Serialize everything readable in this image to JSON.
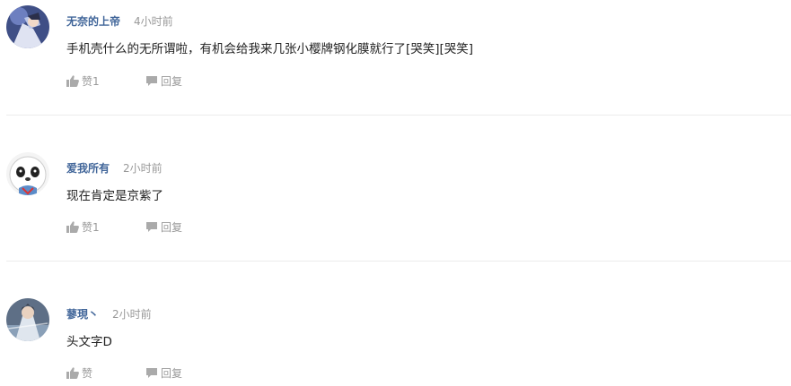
{
  "comments": [
    {
      "username": "无奈的上帝",
      "time": "4小时前",
      "content": "手机壳什么的无所谓啦，有机会给我来几张小樱牌钢化膜就行了[哭笑][哭笑]",
      "like_label": "赞1",
      "reply_label": "回复",
      "avatar": "anime-character-avatar"
    },
    {
      "username": "爱我所有",
      "time": "2小时前",
      "content": "现在肯定是京紫了",
      "like_label": "赞1",
      "reply_label": "回复",
      "avatar": "panda-face-avatar"
    },
    {
      "username": "蓼現丶",
      "time": "2小时前",
      "content": "头文字D",
      "like_label": "赞",
      "reply_label": "回复",
      "avatar": "anime-character-avatar"
    }
  ],
  "colors": {
    "username": "#406599",
    "meta": "#999999",
    "text": "#222222",
    "divider": "#ececec"
  }
}
